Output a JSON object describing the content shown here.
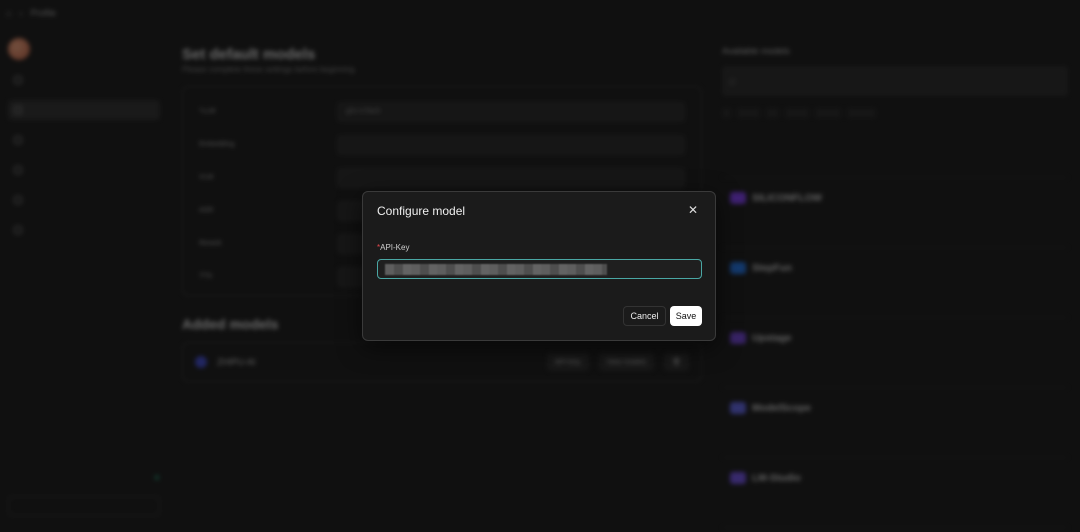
{
  "modal": {
    "title": "Configure model",
    "field_required_mark": "*",
    "field_label": "API-Key",
    "input_value": "",
    "cancel_label": "Cancel",
    "save_label": "Save"
  },
  "background": {
    "breadcrumb": "Profile",
    "main_title": "Set default models",
    "main_subtitle": "Please complete these settings before beginning",
    "default_rows": [
      "*LLM",
      "Embedding",
      "VLM",
      "ASR",
      "Rerank",
      "TTS"
    ],
    "llm_value": "glm-4-flash",
    "added_title": "Added models",
    "added_provider": "ZHIPU-AI",
    "added_api_key": "API-Key",
    "added_view_models": "View models",
    "available_title": "Available models",
    "providers": [
      "SILICONFLOW",
      "StepFun",
      "Upstage",
      "ModelScope",
      "LM-Studio"
    ]
  }
}
